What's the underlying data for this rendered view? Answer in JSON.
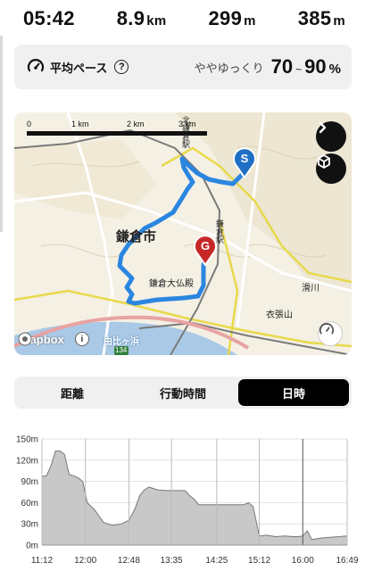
{
  "stats": {
    "time": "05:42",
    "distance_value": "8.9",
    "distance_unit": "km",
    "ascent_value": "299",
    "ascent_unit": "m",
    "descent_value": "385",
    "descent_unit": "m"
  },
  "pace": {
    "label": "平均ペース",
    "help": "?",
    "description": "ややゆっくり",
    "range_low": "70",
    "range_sep": "~",
    "range_high": "90",
    "range_unit": "%"
  },
  "map": {
    "scale_labels": [
      "0",
      "1 km",
      "2 km",
      "3 km"
    ],
    "place_labels": {
      "city": "鎌倉市",
      "station_kamakura": "鎌倉駅",
      "daibutsu": "鎌倉大仏殿",
      "kinubari": "衣張山",
      "yuigahama": "由比ヶ浜",
      "namerikawa": "滑川",
      "station_kita": "北鎌倉駅",
      "route_num": "134"
    },
    "start_marker": "S",
    "goal_marker": "G",
    "attribution": "mapbox",
    "info": "i",
    "route_color": "#2a86e0",
    "start_color": "#1f6fc4",
    "goal_color": "#c62828"
  },
  "tabs": [
    {
      "label": "距離",
      "active": false
    },
    {
      "label": "行動時間",
      "active": false
    },
    {
      "label": "日時",
      "active": true
    }
  ],
  "chart_data": {
    "type": "area",
    "title": "",
    "xlabel": "",
    "ylabel": "",
    "ylim": [
      0,
      150
    ],
    "y_ticks": [
      "0m",
      "30m",
      "60m",
      "90m",
      "120m",
      "150m"
    ],
    "x_ticks": [
      "11:12",
      "12:00",
      "12:48",
      "13:35",
      "14:25",
      "15:12",
      "16:00",
      "16:49"
    ],
    "x": [
      "11:12",
      "11:17",
      "11:22",
      "11:27",
      "11:32",
      "11:37",
      "11:42",
      "11:47",
      "11:52",
      "11:57",
      "12:02",
      "12:10",
      "12:20",
      "12:30",
      "12:40",
      "12:48",
      "12:55",
      "13:00",
      "13:05",
      "13:10",
      "13:15",
      "13:20",
      "13:30",
      "13:35",
      "13:40",
      "13:45",
      "13:50",
      "13:55",
      "14:00",
      "14:05",
      "14:10",
      "14:15",
      "14:25",
      "14:35",
      "14:45",
      "14:55",
      "15:00",
      "15:05",
      "15:12",
      "15:20",
      "15:30",
      "15:40",
      "15:50",
      "15:55",
      "16:00",
      "16:05",
      "16:10",
      "16:20",
      "16:30",
      "16:40",
      "16:49"
    ],
    "values": [
      97,
      98,
      112,
      133,
      133,
      128,
      100,
      98,
      95,
      90,
      60,
      50,
      32,
      28,
      30,
      35,
      52,
      70,
      78,
      82,
      80,
      78,
      77,
      77,
      77,
      77,
      77,
      70,
      65,
      57,
      57,
      57,
      57,
      57,
      57,
      57,
      60,
      55,
      13,
      14,
      12,
      13,
      12,
      12,
      13,
      20,
      8,
      10,
      11,
      12,
      13
    ],
    "fill_color": "#c8c8c8",
    "line_color": "#777777"
  }
}
